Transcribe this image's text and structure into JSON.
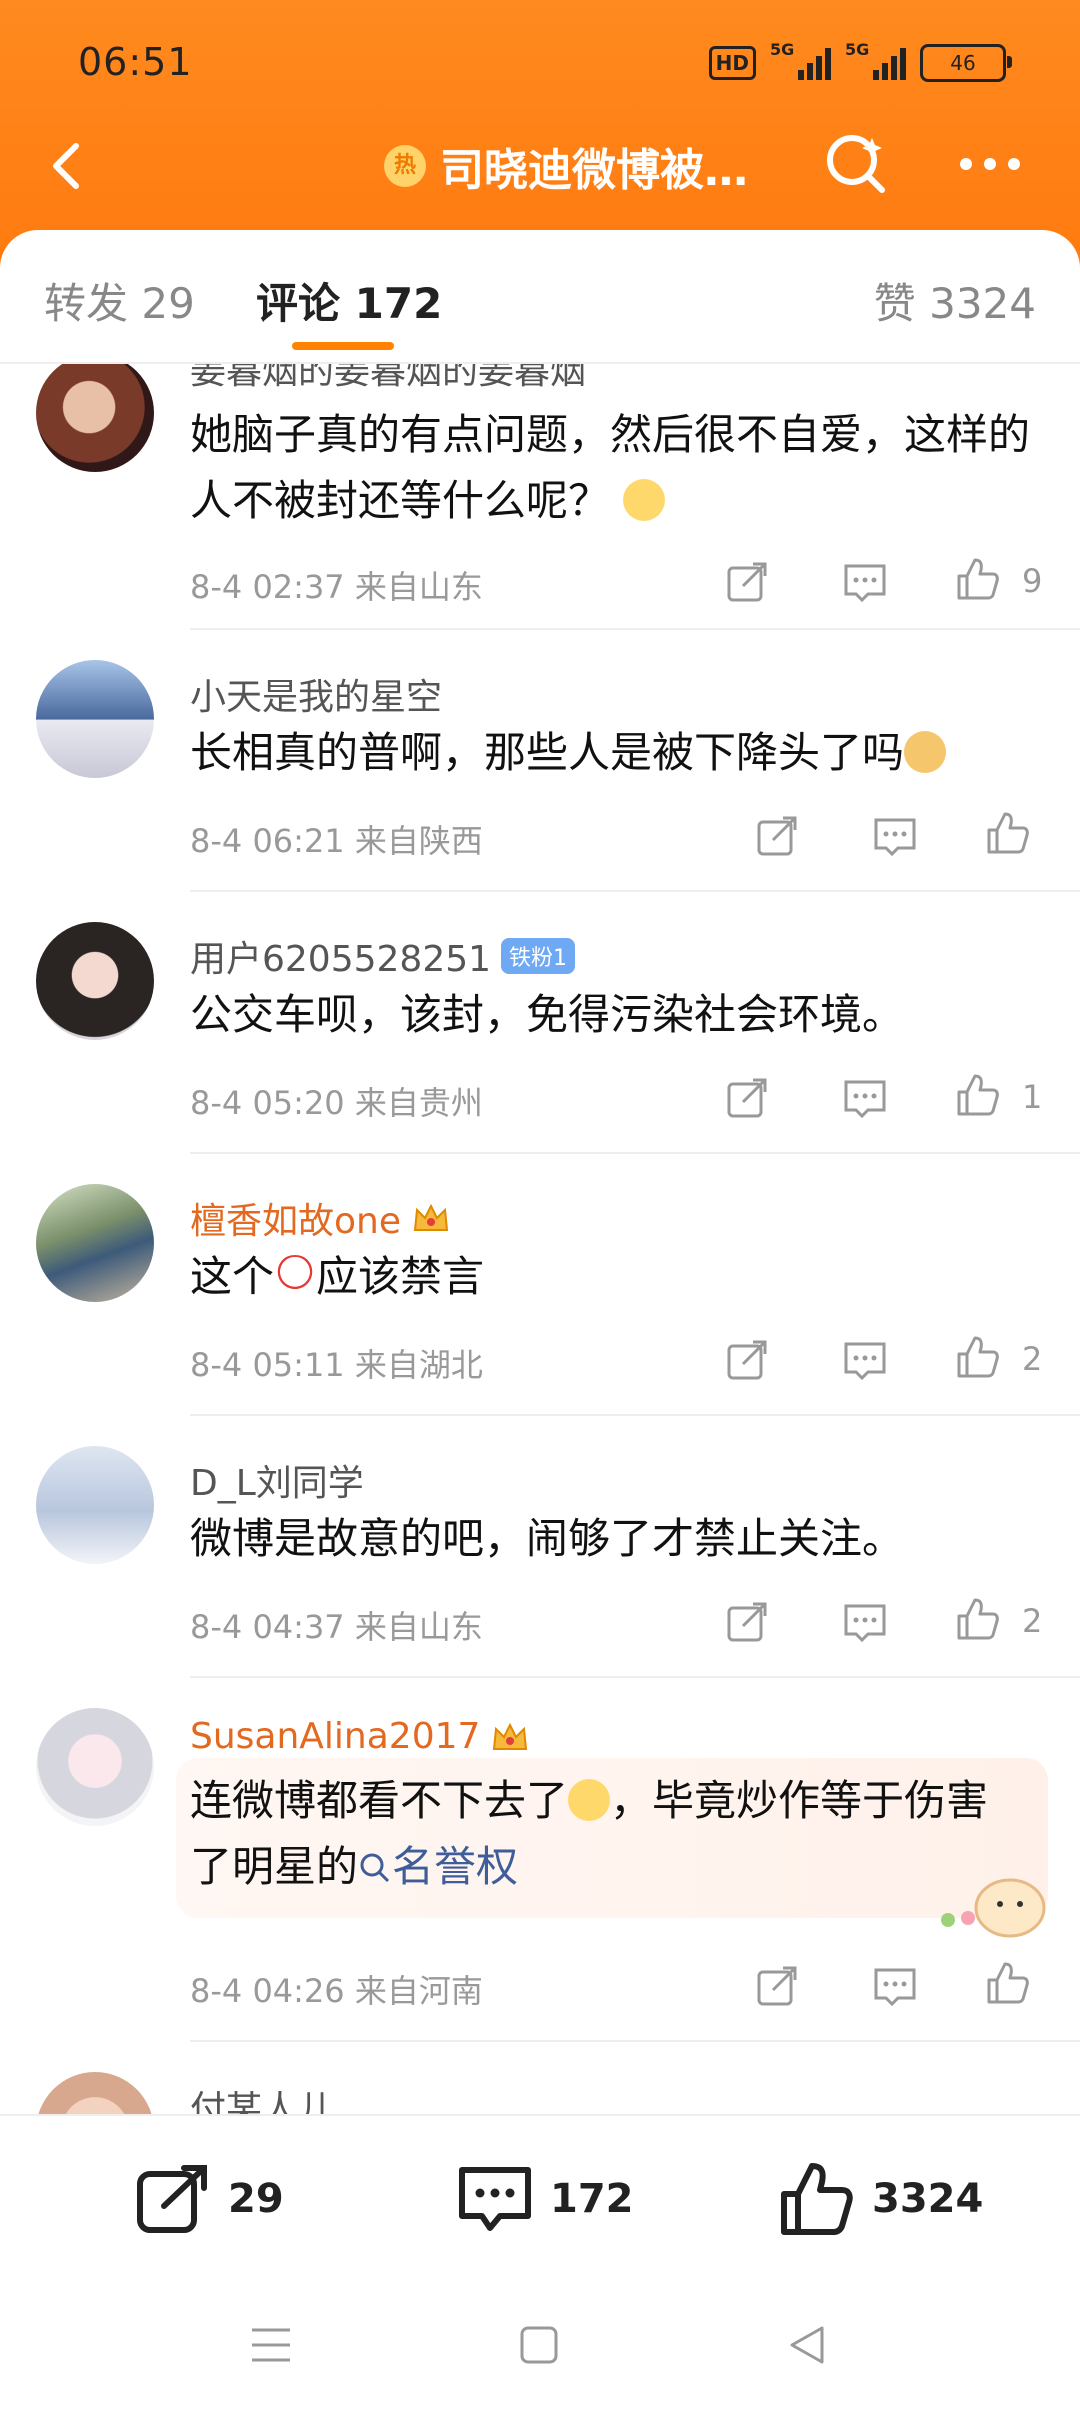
{
  "status_bar": {
    "time": "06:51",
    "hd": "HD",
    "net1": "5G",
    "net2": "5G",
    "battery": "46"
  },
  "nav": {
    "hot_badge": "热",
    "title": "司晓迪微博被…"
  },
  "tabs": {
    "repost": "转发 29",
    "comment": "评论 172",
    "likes": "赞 3324"
  },
  "comments": [
    {
      "user": "姜暮烟的姜暮烟的姜暮烟",
      "text": "她脑子真的有点问题，然后很不自爱，这样的人不被封还等什么呢？",
      "date": "8-4 02:37",
      "from": "来自山东",
      "likes": "9"
    },
    {
      "user": "小天是我的星空",
      "text": "长相真的普啊，那些人是被下降头了吗",
      "date": "8-4 06:21",
      "from": "来自陕西",
      "likes": ""
    },
    {
      "user": "用户6205528251",
      "badge": "铁粉1",
      "text": "公交车呗，该封，免得污染社会环境。",
      "date": "8-4 05:20",
      "from": "来自贵州",
      "likes": "1"
    },
    {
      "user": "檀香如故one",
      "text_a": "这个",
      "text_b": "应该禁言",
      "date": "8-4 05:11",
      "from": "来自湖北",
      "likes": "2"
    },
    {
      "user": "D_L刘同学",
      "text": "微博是故意的吧，闹够了才禁止关注。",
      "date": "8-4 04:37",
      "from": "来自山东",
      "likes": "2"
    },
    {
      "user": "SusanAlina2017",
      "text_a": "连微博都看不下去了",
      "text_b": "，毕竟炒作等于伤害了明星的",
      "link": "名誉权",
      "date": "8-4 04:26",
      "from": "来自河南",
      "likes": ""
    },
    {
      "user": "付某人儿"
    }
  ],
  "bottom": {
    "repost": "29",
    "comment": "172",
    "like": "3324"
  },
  "colors": {
    "accent": "#ff8200",
    "header": "#ff8a1f",
    "vip_name": "#e2691f",
    "link": "#3f5d99"
  }
}
